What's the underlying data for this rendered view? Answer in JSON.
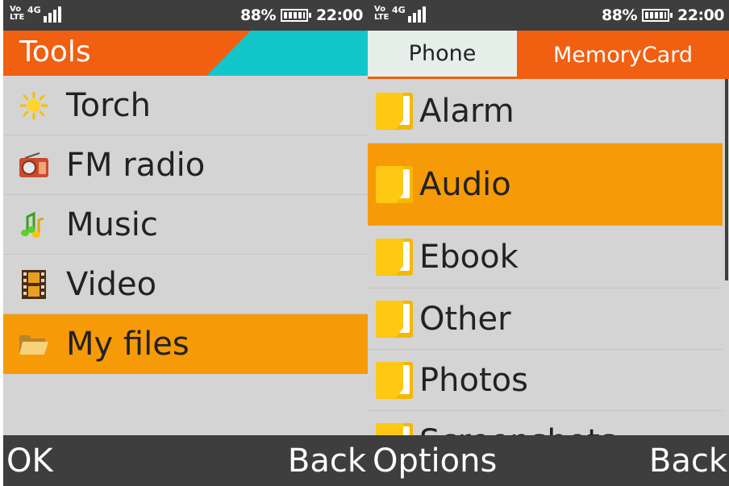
{
  "left_screen": {
    "status": {
      "volte": "Vo LTE",
      "network": "4G",
      "battery": "88%",
      "time": "22:00"
    },
    "title": "Tools",
    "items": [
      {
        "label": "Torch",
        "icon": "sun-icon"
      },
      {
        "label": "FM radio",
        "icon": "radio-icon"
      },
      {
        "label": "Music",
        "icon": "music-note-icon"
      },
      {
        "label": "Video",
        "icon": "film-icon"
      },
      {
        "label": "My files",
        "icon": "folder-open-icon",
        "selected": true
      }
    ],
    "softkeys": {
      "left": "OK",
      "right": "Back"
    }
  },
  "right_screen": {
    "status": {
      "volte": "Vo LTE",
      "network": "4G",
      "battery": "88%",
      "time": "22:00"
    },
    "tabs": [
      {
        "label": "Phone",
        "active": false
      },
      {
        "label": "MemoryCard",
        "active": true
      }
    ],
    "folders": [
      {
        "label": "Alarm"
      },
      {
        "label": "Audio",
        "selected": true
      },
      {
        "label": "Ebook"
      },
      {
        "label": "Other"
      },
      {
        "label": "Photos"
      },
      {
        "label": "Screenshots"
      }
    ],
    "softkeys": {
      "left": "Options",
      "right": "Back"
    }
  },
  "colors": {
    "accent_orange": "#f15f11",
    "selection": "#f79a08",
    "teal": "#12c6c9",
    "bar_dark": "#3e3e3e",
    "list_bg": "#d4d4d4"
  }
}
